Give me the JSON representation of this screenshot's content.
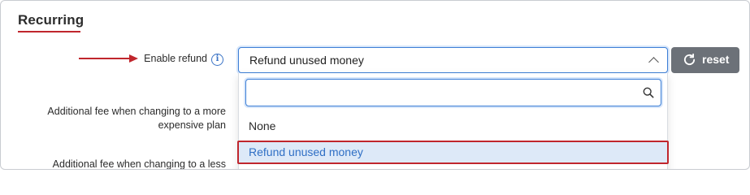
{
  "section": {
    "title": "Recurring"
  },
  "fields": {
    "enable_refund_label": "Enable refund",
    "expensive_fee_label": "Additional fee when changing to a more expensive plan",
    "less_fee_label": "Additional fee when changing to a less"
  },
  "select": {
    "value": "Refund unused money"
  },
  "reset_button": {
    "label": "reset"
  },
  "dropdown": {
    "search_placeholder": "",
    "options": [
      {
        "label": "None",
        "selected": false
      },
      {
        "label": "Refund unused money",
        "selected": true
      }
    ]
  },
  "colors": {
    "accent_red": "#c0262d",
    "focus_blue": "#3d7fd6",
    "selected_bg": "#dde9f8",
    "button_gray": "#6c7178"
  },
  "icons": {
    "info": "info-icon",
    "chevron": "chevron-up-icon",
    "reset": "refresh-icon",
    "search": "search-icon",
    "annotation": "arrow-right-icon"
  }
}
